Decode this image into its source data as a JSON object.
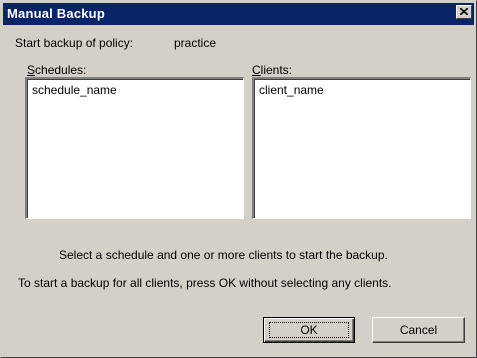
{
  "window": {
    "title": "Manual Backup",
    "close_icon": "close-x-icon"
  },
  "policy": {
    "label": "Start backup of policy:",
    "value": "practice"
  },
  "schedules": {
    "label_mnemonic": "S",
    "label_rest": "chedules:",
    "items": [
      "schedule_name"
    ]
  },
  "clients": {
    "label_mnemonic": "C",
    "label_rest": "lients:",
    "items": [
      "client_name"
    ]
  },
  "instructions": {
    "line1": "Select a schedule and one or more clients to start the backup.",
    "line2": "To start a backup for all clients, press OK without selecting any clients."
  },
  "buttons": {
    "ok": "OK",
    "cancel": "Cancel"
  },
  "colors": {
    "titlebar": "#0a246a",
    "face": "#d4d0c8"
  }
}
